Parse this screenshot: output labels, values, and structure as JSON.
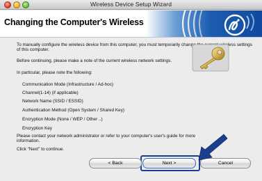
{
  "window": {
    "title": "Wireless Device Setup Wizard"
  },
  "header": {
    "title": "Changing the Computer's Wireless Settings"
  },
  "body": {
    "intro": "To manually configure the wireless device from this computer, you must temporarily change the current wireless settings of this computer.",
    "note_before": "Before continuing, please make a note of the current wireless network settings.",
    "particular": "In particular, please note the following:",
    "settings": [
      "Communication Mode (Infrastructure / Ad-hoc)",
      "Channel(1-14) (if applicable)",
      "Network Name (SSID / ESSID)",
      "Authentication Method (Open System / Shared Key)",
      "Encryption Mode (None / WEP / Other ..)",
      "Encryption Key"
    ],
    "contact": "Please contact your network administrator or refer to your computer's user's guide for more information.",
    "click_next": "Click \"Next\" to continue."
  },
  "buttons": {
    "back": "< Back",
    "next": "Next >",
    "cancel": "Cancel"
  },
  "icons": {
    "key": "key-icon",
    "brand": "brother-wireless-logo-icon",
    "arrow": "pointer-arrow-icon"
  },
  "colors": {
    "banner_blue": "#1d5eb1",
    "highlight": "#1b3f8f"
  }
}
